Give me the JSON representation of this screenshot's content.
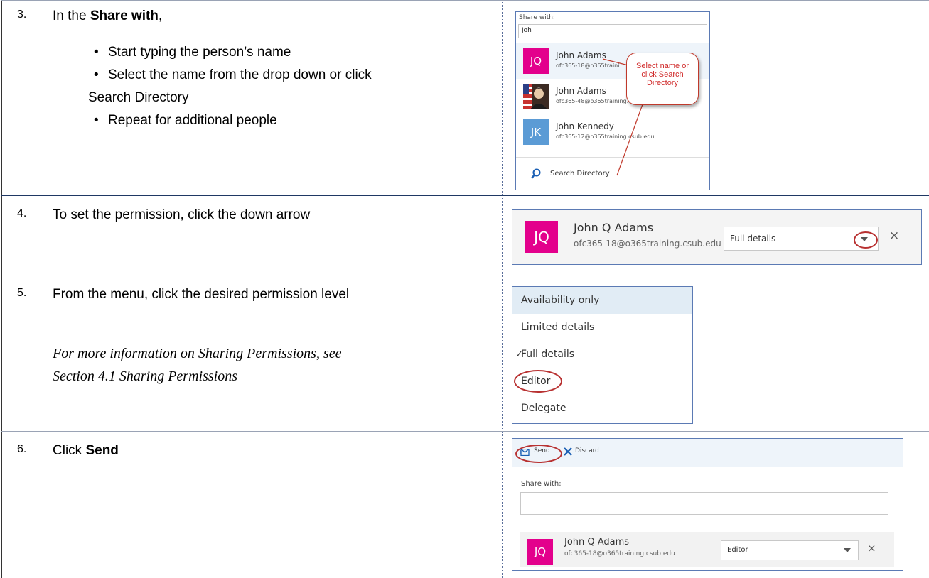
{
  "steps": [
    {
      "number": "3.",
      "intro_prefix": "In the ",
      "intro_bold": "Share with",
      "intro_suffix": ",",
      "bullets": [
        "Start typing the person’s name",
        "Select the name from the drop down or click",
        "Search Directory",
        "Repeat for additional people"
      ]
    },
    {
      "number": "4.",
      "text": "To set the permission, click the down arrow"
    },
    {
      "number": "5.",
      "text": "From the menu, click the desired permission level",
      "note_line1": "For more information on Sharing Permissions, see",
      "note_line2": "Section 4.1 Sharing Permissions"
    },
    {
      "number": "6.",
      "text_prefix": "Click ",
      "text_bold": "Send"
    }
  ],
  "shot1": {
    "label": "Share with:",
    "input_value": "Joh",
    "results": [
      {
        "initials": "JQ",
        "name": "John Adams",
        "email": "ofc365-18@o365traini",
        "color": "#e3008c"
      },
      {
        "initials": "",
        "name": "John Adams",
        "email": "ofc365-48@o365training.csub.edu",
        "color": "#6b3f2a"
      },
      {
        "initials": "JK",
        "name": "John Kennedy",
        "email": "ofc365-12@o365training.csub.edu",
        "color": "#5b9bd5"
      }
    ],
    "search_label": "Search Directory",
    "callout_line1": "Select name or",
    "callout_line2": "click Search",
    "callout_line3": "Directory"
  },
  "shot2": {
    "initials": "JQ",
    "name": "John Q Adams",
    "email": "ofc365-18@o365training.csub.edu",
    "permission": "Full details",
    "close": "×"
  },
  "shot3": {
    "items": [
      "Availability only",
      "Limited details",
      "Full details",
      "Editor",
      "Delegate"
    ],
    "checkmark": "✓"
  },
  "shot4": {
    "send_label": "Send",
    "discard_label": "Discard",
    "label": "Share with:",
    "initials": "JQ",
    "name": "John Q Adams",
    "email": "ofc365-18@o365training.csub.edu",
    "permission": "Editor",
    "close": "×"
  },
  "colors": {
    "accent": "#e3008c",
    "border": "#5b7ab4",
    "callout": "#c0392b",
    "selected_bg": "#e1ecf5"
  }
}
